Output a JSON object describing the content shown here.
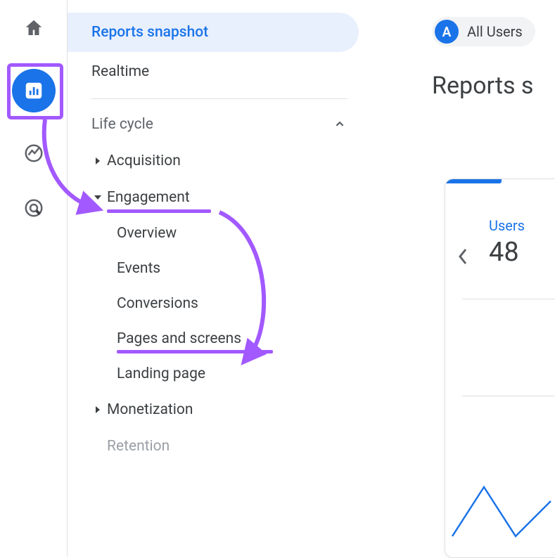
{
  "rail": {
    "home": "Home",
    "reports": "Reports",
    "explore": "Explore",
    "advertising": "Advertising"
  },
  "nav": {
    "snapshot": "Reports snapshot",
    "realtime": "Realtime",
    "section_lifecycle": "Life cycle",
    "cats": {
      "acquisition": "Acquisition",
      "engagement": "Engagement",
      "monetization": "Monetization",
      "retention": "Retention"
    },
    "engagement_sub": {
      "overview": "Overview",
      "events": "Events",
      "conversions": "Conversions",
      "pages": "Pages and screens",
      "landing": "Landing page"
    }
  },
  "main": {
    "chip_letter": "A",
    "chip_label": "All Users",
    "title": "Reports s",
    "metric_label": "Users",
    "metric_value": "48"
  },
  "colors": {
    "accent": "#1a73e8",
    "annotation": "#a259ff"
  }
}
